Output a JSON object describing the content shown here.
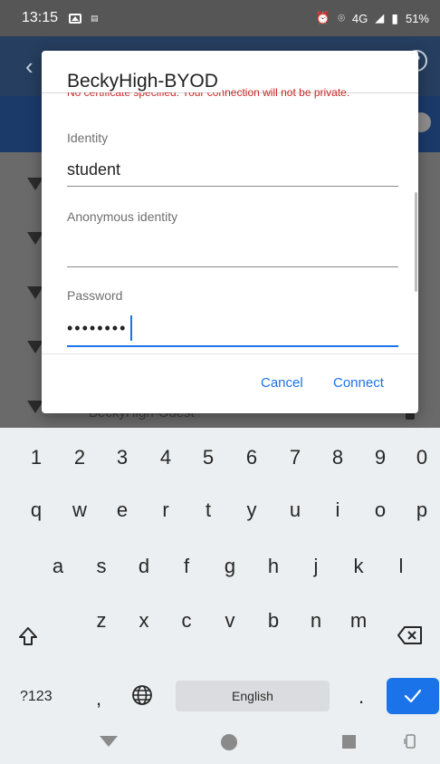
{
  "status_bar": {
    "time": "13:15",
    "network": "4G",
    "battery": "51%"
  },
  "dialog": {
    "title": "BeckyHigh-BYOD",
    "warning": "No certificate specified. Your connection will not be private.",
    "identity_label": "Identity",
    "identity_value": "student",
    "anonymous_label": "Anonymous identity",
    "anonymous_value": "",
    "password_label": "Password",
    "password_value": "••••••••",
    "cancel_label": "Cancel",
    "connect_label": "Connect"
  },
  "background_list": {
    "guest_network": "BeckyHigh-Guest"
  },
  "keyboard": {
    "numbers": [
      "1",
      "2",
      "3",
      "4",
      "5",
      "6",
      "7",
      "8",
      "9",
      "0"
    ],
    "row1": [
      "q",
      "w",
      "e",
      "r",
      "t",
      "y",
      "u",
      "i",
      "o",
      "p"
    ],
    "row2": [
      "a",
      "s",
      "d",
      "f",
      "g",
      "h",
      "j",
      "k",
      "l"
    ],
    "row3": [
      "z",
      "x",
      "c",
      "v",
      "b",
      "n",
      "m"
    ],
    "symbols_label": "?123",
    "comma": ",",
    "space_label": "English",
    "period": "."
  },
  "colors": {
    "accent": "#1a73e8",
    "warning": "#c62828"
  }
}
